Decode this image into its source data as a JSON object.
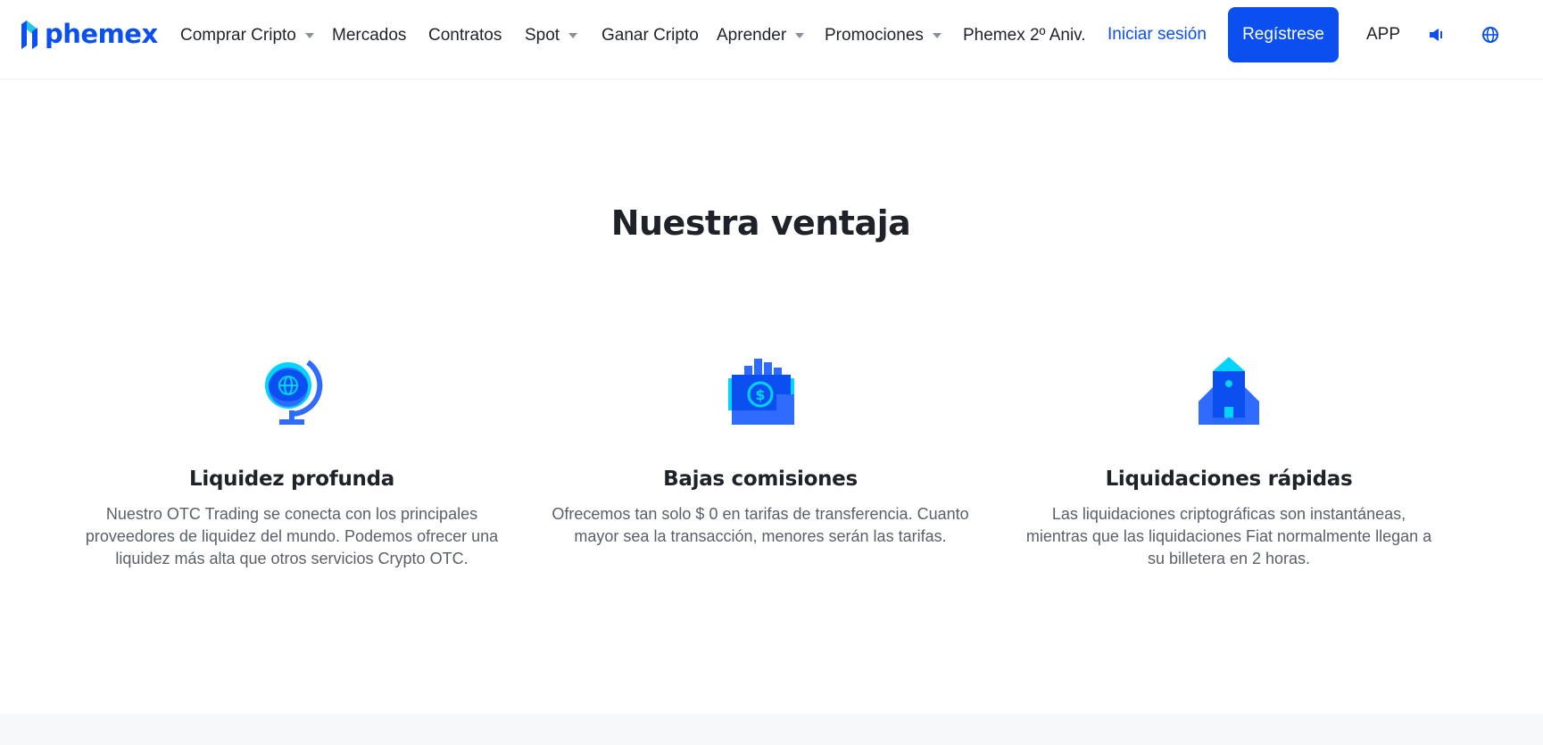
{
  "header": {
    "logo_text": "phemex",
    "nav": [
      {
        "label": "Comprar Cripto",
        "dropdown": true
      },
      {
        "label": "Mercados",
        "dropdown": false
      },
      {
        "label": "Contratos",
        "dropdown": false
      },
      {
        "label": "Spot",
        "dropdown": true
      },
      {
        "label": "Ganar Cripto",
        "dropdown": false
      },
      {
        "label": "Aprender",
        "dropdown": true
      },
      {
        "label": "Promociones",
        "dropdown": true
      },
      {
        "label": "Phemex 2º Aniv.",
        "dropdown": false
      }
    ],
    "login_label": "Iniciar sesión",
    "register_label": "Regístrese",
    "app_label": "APP",
    "icons": [
      "speaker-icon",
      "globe-icon"
    ]
  },
  "main": {
    "title": "Nuestra ventaja",
    "features": [
      {
        "icon": "globe-icon",
        "title": "Liquidez profunda",
        "description": "Nuestro OTC Trading se conecta con los principales proveedores de liquidez del mundo. Podemos ofrecer una liquidez más alta que otros servicios Crypto OTC."
      },
      {
        "icon": "money-hand-icon",
        "title": "Bajas comisiones",
        "description": "Ofrecemos tan solo $ 0 en tarifas de transferencia. Cuanto mayor sea la transacción, menores serán las tarifas."
      },
      {
        "icon": "rocket-icon",
        "title": "Liquidaciones rápidas",
        "description": "Las liquidaciones criptográficas son instantáneas, mientras que las liquidaciones Fiat normalmente llegan a su billetera en 2 horas."
      }
    ]
  },
  "colors": {
    "brand_blue": "#0b4ff0",
    "icon_blue": "#2f6bff",
    "icon_cyan": "#00d4ff",
    "text_dark": "#1f2329",
    "text_muted": "#5a5f69"
  }
}
